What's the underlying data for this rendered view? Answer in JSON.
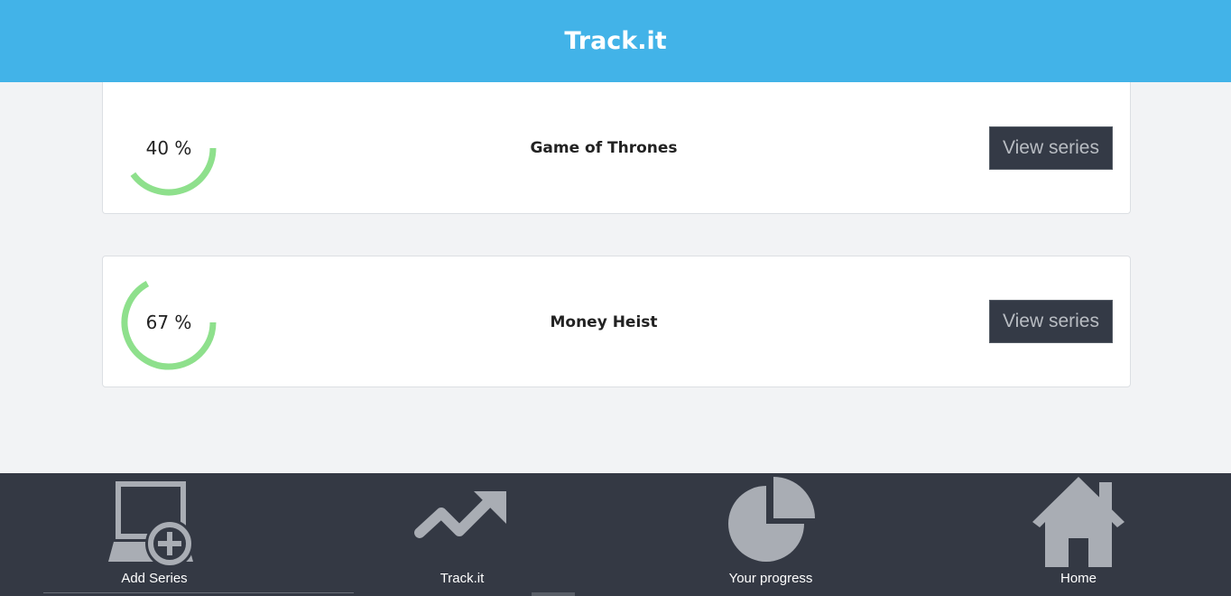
{
  "header": {
    "title": "Track.it"
  },
  "series": [
    {
      "name": "Game of Thrones",
      "progress_label": "40 %",
      "progress": 0.4,
      "button_label": "View series"
    },
    {
      "name": "Money Heist",
      "progress_label": "67 %",
      "progress": 0.67,
      "button_label": "View series"
    }
  ],
  "nav": [
    {
      "label": "Add Series",
      "icon": "add-monitor-icon"
    },
    {
      "label": "Track.it",
      "icon": "trending-up-icon"
    },
    {
      "label": "Your progress",
      "icon": "pie-chart-icon"
    },
    {
      "label": "Home",
      "icon": "home-icon"
    }
  ],
  "colors": {
    "header_bg": "#42b3e8",
    "ring": "#8ee08c",
    "nav_bg": "#343944",
    "icon": "#a9adb4",
    "button_bg": "#343a46"
  }
}
